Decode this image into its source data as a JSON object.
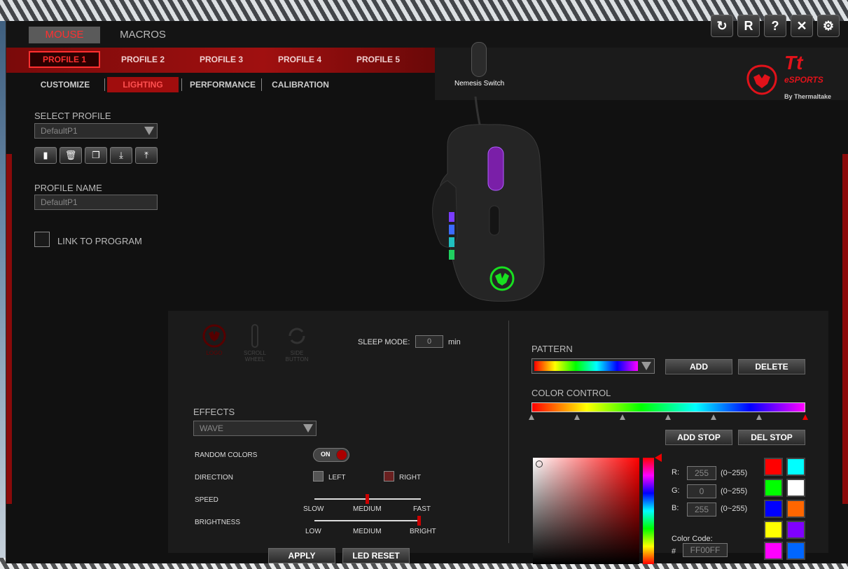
{
  "main_tabs": [
    "MOUSE",
    "MACROS"
  ],
  "window_buttons": [
    "↻",
    "R",
    "?",
    "✕",
    "⚙"
  ],
  "profile_tabs": [
    "PROFILE 1",
    "PROFILE 2",
    "PROFILE 3",
    "PROFILE 4",
    "PROFILE 5"
  ],
  "sub_tabs": [
    "CUSTOMIZE",
    "LIGHTING",
    "PERFORMANCE",
    "CALIBRATION"
  ],
  "device": {
    "name": "Nemesis Switch"
  },
  "brand": {
    "name": "Tt",
    "line": "eSPORTS",
    "by": "By Thermaltake"
  },
  "left": {
    "select_profile_label": "SELECT PROFILE",
    "select_profile_value": "DefaultP1",
    "profile_name_label": "PROFILE NAME",
    "profile_name_value": "DefaultP1",
    "link_label": "LINK TO PROGRAM"
  },
  "lighting": {
    "zones": [
      "LOGO",
      "SCROLL WHEEL",
      "SIDE BUTTON"
    ],
    "sleep_label": "SLEEP MODE:",
    "sleep_value": "0",
    "sleep_unit": "min",
    "effects_label": "EFFECTS",
    "effect_value": "WAVE",
    "random_label": "RANDOM COLORS",
    "random_state": "ON",
    "direction_label": "DIRECTION",
    "direction_left": "LEFT",
    "direction_right": "RIGHT",
    "speed_label": "SPEED",
    "speed_ticks": [
      "SLOW",
      "MEDIUM",
      "FAST"
    ],
    "speed_level": 0.5,
    "brightness_label": "BRIGHTNESS",
    "brightness_ticks": [
      "LOW",
      "MEDIUM",
      "BRIGHT"
    ],
    "brightness_level": 1.0,
    "apply": "APPLY",
    "led_reset": "LED RESET"
  },
  "color": {
    "pattern_label": "PATTERN",
    "add": "ADD",
    "delete": "DELETE",
    "color_control_label": "COLOR CONTROL",
    "add_stop": "ADD STOP",
    "del_stop": "DEL STOP",
    "r_label": "R:",
    "r_value": "255",
    "g_label": "G:",
    "g_value": "0",
    "b_label": "B:",
    "b_value": "255",
    "range": "(0~255)",
    "code_label": "Color Code:",
    "hash": "#",
    "code_value": "FF00FF",
    "swatches": [
      "#ff0000",
      "#00ffff",
      "#00ff00",
      "#ffffff",
      "#0000ff",
      "#ff6600",
      "#ffff00",
      "#8000ff",
      "#ff00ff",
      "#0066ff"
    ]
  }
}
